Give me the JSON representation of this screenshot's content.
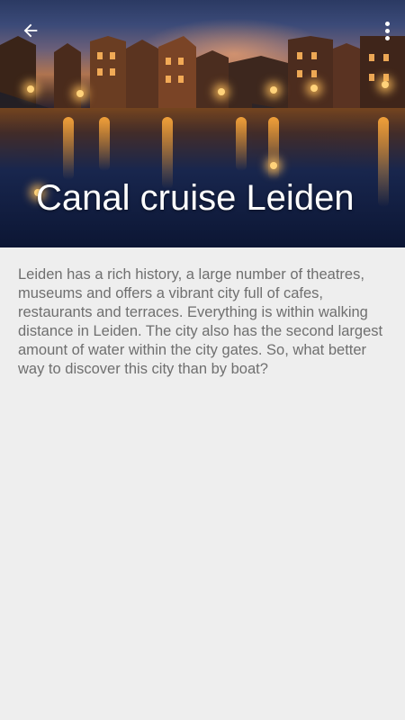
{
  "header": {
    "title": "Canal cruise Leiden",
    "back_icon": "arrow-left-icon",
    "menu_icon": "more-vert-icon"
  },
  "content": {
    "description": "Leiden has a rich history, a large number of theatres, museums and offers a vibrant city full of cafes, restaurants and terraces. Everything is within walking distance in Leiden. The city also has the second largest amount of water within the city gates. So, what better way to discover this city than by boat?"
  },
  "colors": {
    "background": "#eeeeee",
    "text": "#6f6f6f",
    "title": "#ffffff"
  }
}
